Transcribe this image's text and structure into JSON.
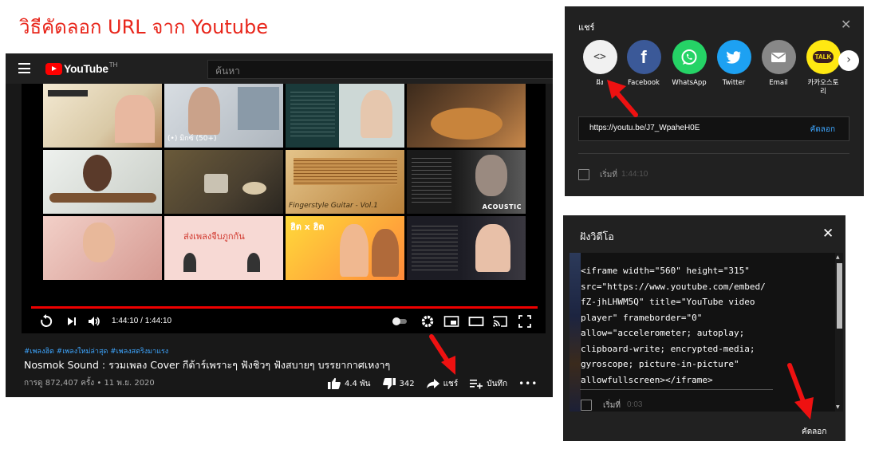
{
  "page_title": "วิธีคัดลอก URL จาก Youtube",
  "youtube": {
    "logo_text": "YouTube",
    "region": "TH",
    "search_placeholder": "ค้นหา",
    "thumbnails": [
      {
        "label": ""
      },
      {
        "label": "(•) มิกซ์ (50+)"
      },
      {
        "label": ""
      },
      {
        "label": ""
      },
      {
        "label": ""
      },
      {
        "label": ""
      },
      {
        "label": "Fingerstyle Guitar - Vol.1"
      },
      {
        "label": "ACOUSTIC"
      },
      {
        "label": ""
      },
      {
        "label": "ส่งเพลงจีบภูกกัน"
      },
      {
        "label": "ฮิต x ฮิต"
      },
      {
        "label": ""
      }
    ],
    "time": "1:44:10 / 1:44:10",
    "hashtags": "#เพลงฮิต #เพลงใหม่ล่าสุด #เพลงสตริงมาแรง",
    "video_title": "Nosmok Sound : รวมเพลง Cover กีต้าร์เพราะๆ ฟังชิวๆ ฟังสบายๆ บรรยากาศเหงาๆ",
    "video_meta": "การดู 872,407 ครั้ง • 11 พ.ย. 2020",
    "likes": "4.4 พัน",
    "dislikes": "342",
    "share_label": "แชร์",
    "save_label": "บันทึก",
    "more_label": "•••"
  },
  "share_dialog": {
    "title": "แชร์",
    "close": "✕",
    "items": [
      {
        "label": "ฝัง",
        "icon": "embed-code-icon",
        "color": "#f1f1f1"
      },
      {
        "label": "Facebook",
        "icon": "facebook-icon",
        "color": "#3b5998"
      },
      {
        "label": "WhatsApp",
        "icon": "whatsapp-icon",
        "color": "#25d366"
      },
      {
        "label": "Twitter",
        "icon": "twitter-icon",
        "color": "#1da1f2"
      },
      {
        "label": "Email",
        "icon": "email-icon",
        "color": "#888888"
      },
      {
        "label": "카카오스토리",
        "icon": "kakao-talk-icon",
        "color": "#ffe812"
      }
    ],
    "url": "https://youtu.be/J7_WpaheH0E",
    "copy": "คัดลอก",
    "start_label": "เริ่มที่",
    "start_time": "1:44:10"
  },
  "embed_dialog": {
    "title": "ฝังวิดีโอ",
    "close": "✕",
    "code": "<iframe width=\"560\" height=\"315\"\nsrc=\"https://www.youtube.com/embed/\nfZ-jhLHWM5Q\" title=\"YouTube video\nplayer\" frameborder=\"0\"\nallow=\"accelerometer; autoplay;\nclipboard-write; encrypted-media;\ngyroscope; picture-in-picture\"\nallowfullscreen></iframe>",
    "start_label": "เริ่มที่",
    "start_time": "0:03",
    "copy": "คัดลอก"
  },
  "colors": {
    "accent_red": "#e8261b",
    "link_blue": "#3ea6ff",
    "annotation_arrow": "#ee1111"
  }
}
